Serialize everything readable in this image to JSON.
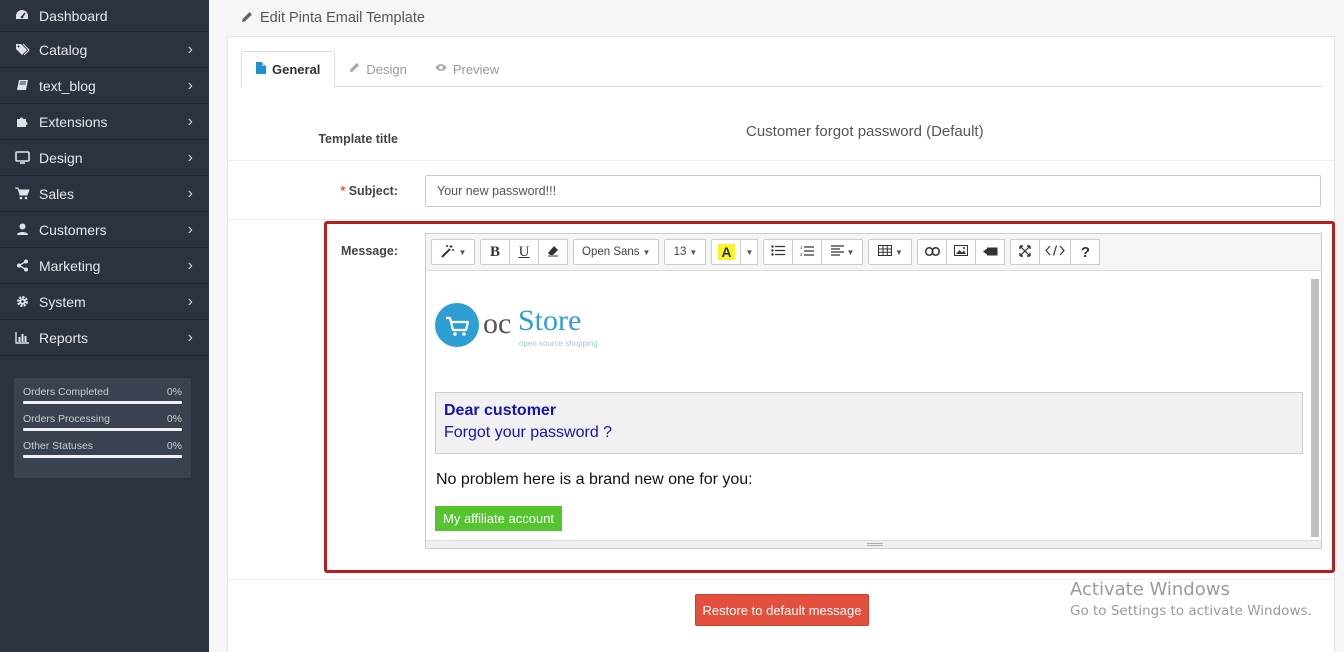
{
  "sidebar": {
    "items": [
      {
        "label": "Dashboard",
        "icon": "dashboard-icon",
        "chevron": false
      },
      {
        "label": "Catalog",
        "icon": "tags-icon",
        "chevron": true
      },
      {
        "label": "text_blog",
        "icon": "book-icon",
        "chevron": true
      },
      {
        "label": "Extensions",
        "icon": "puzzle-icon",
        "chevron": true
      },
      {
        "label": "Design",
        "icon": "monitor-icon",
        "chevron": true
      },
      {
        "label": "Sales",
        "icon": "cart-icon",
        "chevron": true
      },
      {
        "label": "Customers",
        "icon": "user-icon",
        "chevron": true
      },
      {
        "label": "Marketing",
        "icon": "share-icon",
        "chevron": true
      },
      {
        "label": "System",
        "icon": "cog-icon",
        "chevron": true
      },
      {
        "label": "Reports",
        "icon": "bar-chart-icon",
        "chevron": true
      }
    ],
    "stats": [
      {
        "label": "Orders Completed",
        "value": "0%",
        "progress": 0
      },
      {
        "label": "Orders Processing",
        "value": "0%",
        "progress": 0
      },
      {
        "label": "Other Statuses",
        "value": "0%",
        "progress": 0
      }
    ]
  },
  "header": {
    "title": "Edit Pinta Email Template"
  },
  "tabs": [
    {
      "label": "General",
      "icon": "file-icon",
      "active": true
    },
    {
      "label": "Design",
      "icon": "pencil-icon",
      "active": false
    },
    {
      "label": "Preview",
      "icon": "eye-icon",
      "active": false
    }
  ],
  "form": {
    "template_title_label": "Template title",
    "template_title_value": "Customer forgot password (Default)",
    "subject_label": "Subject:",
    "subject_required": "*",
    "subject_value": "Your new password!!!",
    "message_label": "Message:"
  },
  "toolbar": {
    "font_name": "Open Sans",
    "font_size": "13",
    "highlight_letter": "A"
  },
  "email": {
    "logo_oc": "oc",
    "logo_store": "Store",
    "logo_tagline": "open source shopping",
    "greeting_title": "Dear customer",
    "greeting_sub": "Forgot your password ?",
    "body_text": "No problem here is a brand new one for you:",
    "button_label": "My affiliate account"
  },
  "restore_label": "Restore to default message",
  "watermark": {
    "title": "Activate Windows",
    "subtitle": "Go to Settings to activate Windows."
  },
  "colors": {
    "sidebar_bg": "#2b3341",
    "accent": "#1e91cf",
    "highlight_border": "#b5201e",
    "restore_button": "#e3503e",
    "affiliate_button": "#55c42e",
    "greeting_text": "#1414b0"
  }
}
